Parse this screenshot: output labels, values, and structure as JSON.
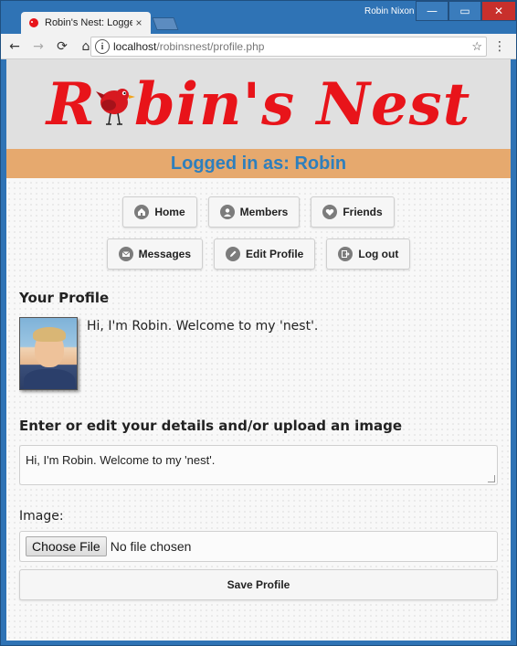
{
  "window": {
    "user": "Robin Nixon",
    "controls": {
      "minimize": "—",
      "maximize": "▭",
      "close": "✕"
    }
  },
  "tab": {
    "title": "Robin's Nest: Logged in",
    "close": "×"
  },
  "toolbar": {
    "back": "←",
    "forward": "→",
    "reload": "⟳",
    "home": "⌂",
    "info": "i",
    "url_host": "localhost",
    "url_path": "/robinsnest/profile.php",
    "star": "☆",
    "menu": "⋮"
  },
  "site": {
    "logo_left": "R",
    "logo_right": "bin's Nest",
    "status": "Logged in as: Robin"
  },
  "menu": {
    "row1": [
      {
        "label": "Home",
        "icon": "home-icon"
      },
      {
        "label": "Members",
        "icon": "user-icon"
      },
      {
        "label": "Friends",
        "icon": "heart-icon"
      }
    ],
    "row2": [
      {
        "label": "Messages",
        "icon": "mail-icon"
      },
      {
        "label": "Edit Profile",
        "icon": "pencil-icon"
      },
      {
        "label": "Log out",
        "icon": "logout-icon"
      }
    ]
  },
  "profile": {
    "heading": "Your Profile",
    "bio": "Hi, I'm Robin. Welcome to my 'nest'."
  },
  "form": {
    "heading": "Enter or edit your details and/or upload an image",
    "bio_value": "Hi, I'm Robin. Welcome to my 'nest'.",
    "image_label": "Image:",
    "choose_file": "Choose File",
    "no_file": "No file chosen",
    "save": "Save Profile"
  },
  "colors": {
    "logo": "#e8141a",
    "status_bg": "#e6a96e",
    "status_text": "#2e7fbd",
    "chrome_blue": "#2f73b5",
    "close_red": "#c8302c"
  }
}
